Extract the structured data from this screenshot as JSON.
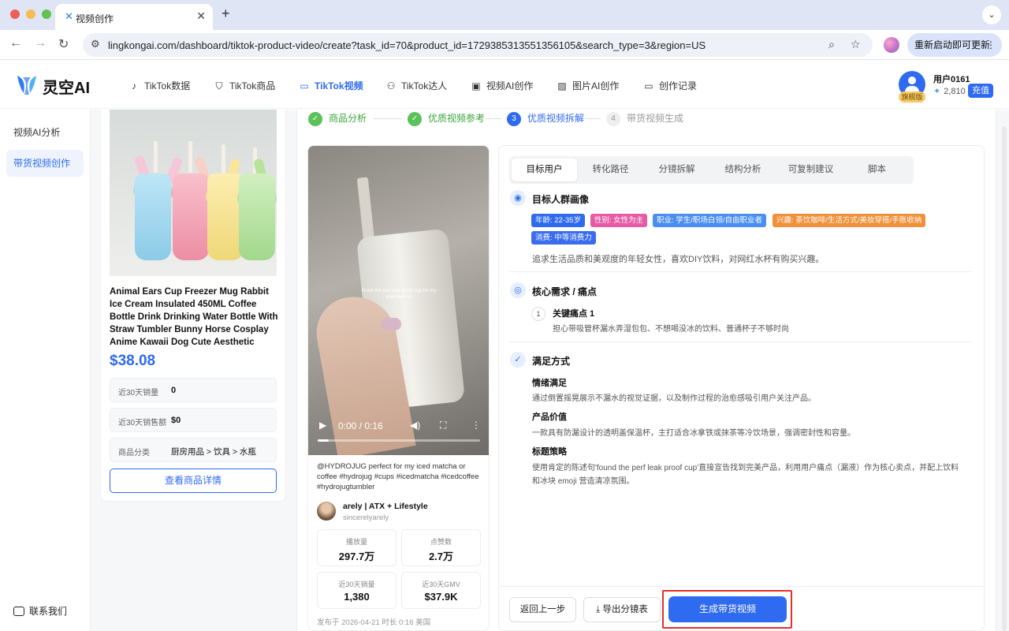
{
  "browser": {
    "tab_title": "视频创作",
    "url": "lingkongai.com/dashboard/tiktok-product-video/create?task_id=70&product_id=1729385313551356105&search_type=3&region=US",
    "update_label": "重新启动即可更新"
  },
  "header": {
    "logo_text": "灵空AI",
    "nav": [
      {
        "label": "TikTok数据",
        "icon": "music-note-icon"
      },
      {
        "label": "TikTok商品",
        "icon": "shopping-bag-icon"
      },
      {
        "label": "TikTok视频",
        "icon": "video-camera-icon"
      },
      {
        "label": "TikTok达人",
        "icon": "users-icon"
      },
      {
        "label": "视频AI创作",
        "icon": "video-ai-icon"
      },
      {
        "label": "图片AI创作",
        "icon": "image-icon"
      },
      {
        "label": "创作记录",
        "icon": "folder-icon"
      }
    ],
    "active_nav": "TikTok视频",
    "user": {
      "name": "用户0161",
      "badge": "旗舰版",
      "credits": "2,810",
      "recharge": "充值"
    }
  },
  "sidebar": {
    "items": [
      {
        "label": "视频AI分析"
      },
      {
        "label": "带货视频创作"
      }
    ],
    "active": "带货视频创作",
    "contact": "联系我们"
  },
  "product": {
    "title": "Animal Ears Cup Freezer Mug Rabbit Ice Cream Insulated 450ML Coffee Bottle Drink Drinking Water Bottle With Straw Tumbler Bunny Horse Cosplay Anime Kawaii Dog Cute Aesthetic",
    "price": "$38.08",
    "stats": [
      {
        "label": "近30天销量",
        "value": "0"
      },
      {
        "label": "近30天销售额",
        "value": "$0"
      },
      {
        "label": "商品分类",
        "value": "厨房用品 > 饮具 > 水瓶"
      }
    ],
    "detail_button": "查看商品详情"
  },
  "steps": [
    {
      "num": "1",
      "label": "商品分析",
      "state": "done"
    },
    {
      "num": "2",
      "label": "优质视频参考",
      "state": "done"
    },
    {
      "num": "3",
      "label": "优质视频拆解",
      "state": "current"
    },
    {
      "num": "4",
      "label": "带货视频生成",
      "state": "todo"
    }
  ],
  "video": {
    "overlay_text": "found the perf leak proof cup for my iced matcha",
    "time": "0:00 / 0:16",
    "progress": 0.0,
    "description": "@HYDROJUG perfect for my iced matcha or coffee #hydrojug #cups #icedmatcha #icedcoffee #hydrojugtumbler",
    "author": "arely | ATX + Lifestyle",
    "handle": "sincerelyarely",
    "stats": [
      {
        "label": "播放量",
        "value": "297.7万"
      },
      {
        "label": "点赞数",
        "value": "2.7万"
      },
      {
        "label": "近30天销量",
        "value": "1,380"
      },
      {
        "label": "近30天GMV",
        "value": "$37.9K"
      }
    ],
    "meta": "发布于 2026-04-21   时长 0:16   美国"
  },
  "analysis": {
    "tabs": [
      "目标用户",
      "转化路径",
      "分镜拆解",
      "结构分析",
      "可复制建议",
      "脚本"
    ],
    "active_tab": "目标用户",
    "persona": {
      "title": "目标人群画像",
      "tags": [
        {
          "text": "年龄: 22-35岁",
          "color": "#2f6bf0"
        },
        {
          "text": "性别: 女性为主",
          "color": "#e65aa6"
        },
        {
          "text": "职业: 学生/职场白领/自由职业者",
          "color": "#4a8ff0"
        },
        {
          "text": "兴趣: 茶饮咖啡/生活方式/美妆穿搭/手账收纳",
          "color": "#f0903a"
        },
        {
          "text": "消费: 中等消费力",
          "color": "#3a6cf0"
        }
      ],
      "summary": "追求生活品质和美观度的年轻女性，喜欢DIY饮料，对网红水杯有购买兴趣。"
    },
    "needs": {
      "title": "核心需求 / 痛点",
      "items": [
        {
          "num": "1",
          "title": "关键痛点 1",
          "desc": "担心带吸管杯漏水弄湿包包、不想喝没冰的饮料、普通杯子不够时尚"
        }
      ]
    },
    "satisfaction": {
      "title": "满足方式",
      "items": [
        {
          "title": "情绪满足",
          "desc": "通过倒置摇晃展示不漏水的视觉证据，以及制作过程的治愈感吸引用户关注产品。"
        },
        {
          "title": "产品价值",
          "desc": "一款具有防漏设计的透明盖保温杯，主打适合冰拿铁或抹茶等冷饮场景，强调密封性和容量。"
        },
        {
          "title": "标题策略",
          "desc": "使用肯定的陈述句'found the perf leak proof cup'直接宣告找到完美产品，利用用户痛点（漏液）作为核心卖点，并配上饮料",
          "desc2": "和冰块 emoji 营造清凉氛围。"
        }
      ]
    },
    "buttons": {
      "back": "返回上一步",
      "export": "导出分镜表",
      "generate": "生成带货视频"
    }
  }
}
